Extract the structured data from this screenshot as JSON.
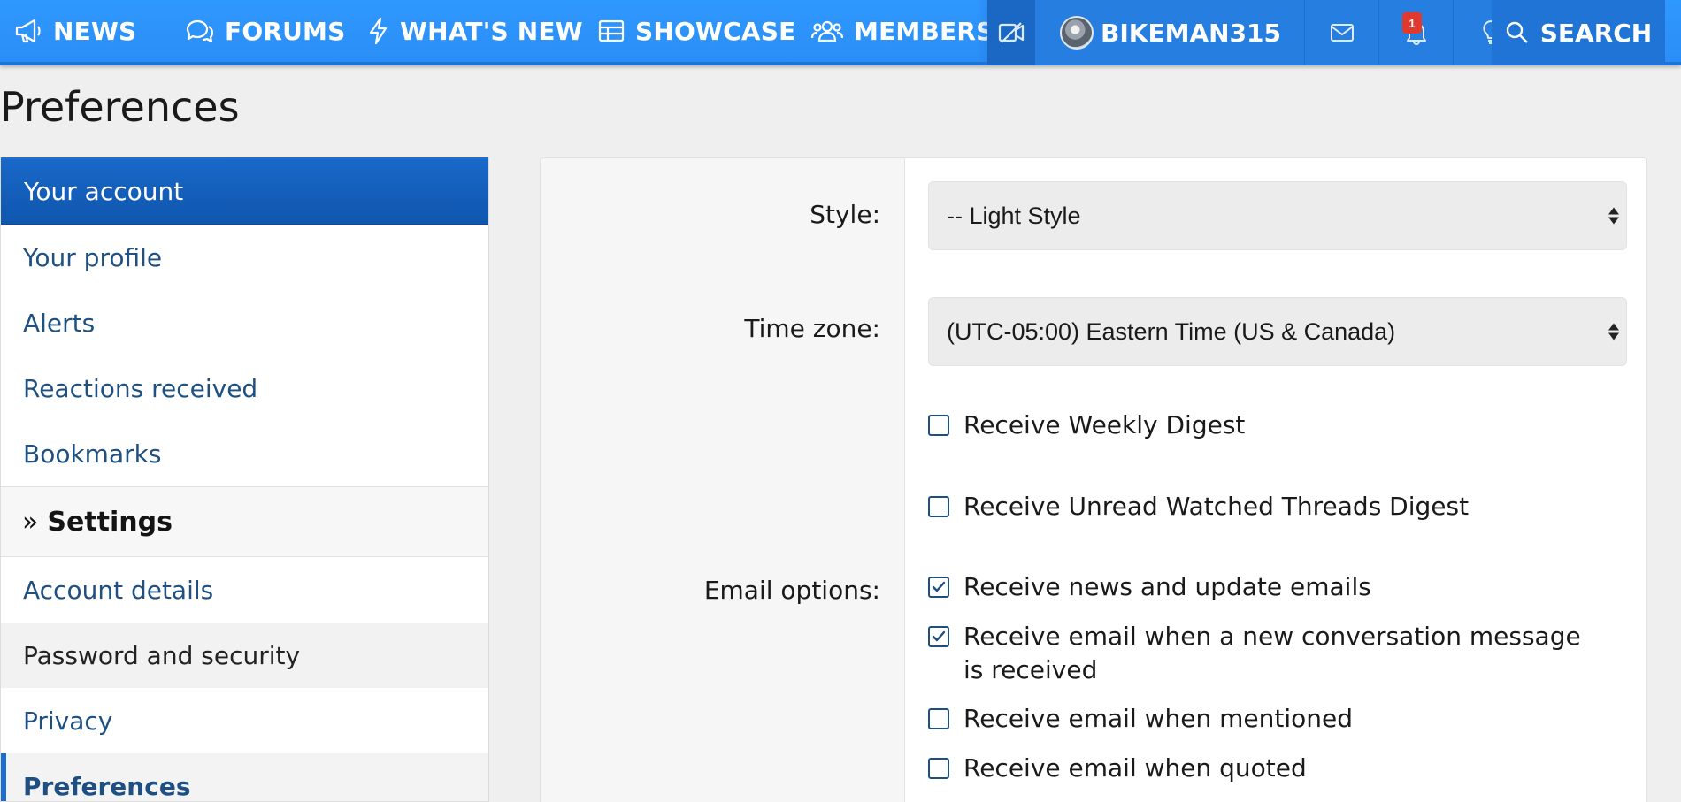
{
  "nav": {
    "items": [
      {
        "label": "NEWS",
        "icon": "megaphone-icon"
      },
      {
        "label": "FORUMS",
        "icon": "chat-bubbles-icon"
      },
      {
        "label": "WHAT'S NEW",
        "icon": "bolt-icon"
      },
      {
        "label": "SHOWCASE",
        "icon": "table-icon"
      },
      {
        "label": "MEMBERS",
        "icon": "users-icon"
      }
    ],
    "username": "BIKEMAN315",
    "alert_count": "1",
    "search_label": "SEARCH"
  },
  "page": {
    "title": "Preferences"
  },
  "sidebar": {
    "header": "Your account",
    "links": [
      "Your profile",
      "Alerts",
      "Reactions received",
      "Bookmarks"
    ],
    "section": "Settings",
    "settings_links": [
      "Account details",
      "Password and security",
      "Privacy",
      "Preferences"
    ],
    "active": "Preferences"
  },
  "form": {
    "style_label": "Style:",
    "style_value": "-- Light Style",
    "timezone_label": "Time zone:",
    "timezone_value": "(UTC-05:00) Eastern Time (US & Canada)",
    "digests": [
      {
        "label": "Receive Weekly Digest",
        "checked": false
      },
      {
        "label": "Receive Unread Watched Threads Digest",
        "checked": false
      }
    ],
    "email_label": "Email options:",
    "email_options": [
      {
        "label": "Receive news and update emails",
        "checked": true
      },
      {
        "label": "Receive email when a new conversation message is received",
        "checked": true
      },
      {
        "label": "Receive email when mentioned",
        "checked": false
      },
      {
        "label": "Receive email when quoted",
        "checked": false
      }
    ]
  },
  "colors": {
    "nav_bg": "#2a8ef6",
    "sidebar_header": "#1265c4",
    "link": "#1f5082",
    "checkbox": "#1f4f82"
  }
}
